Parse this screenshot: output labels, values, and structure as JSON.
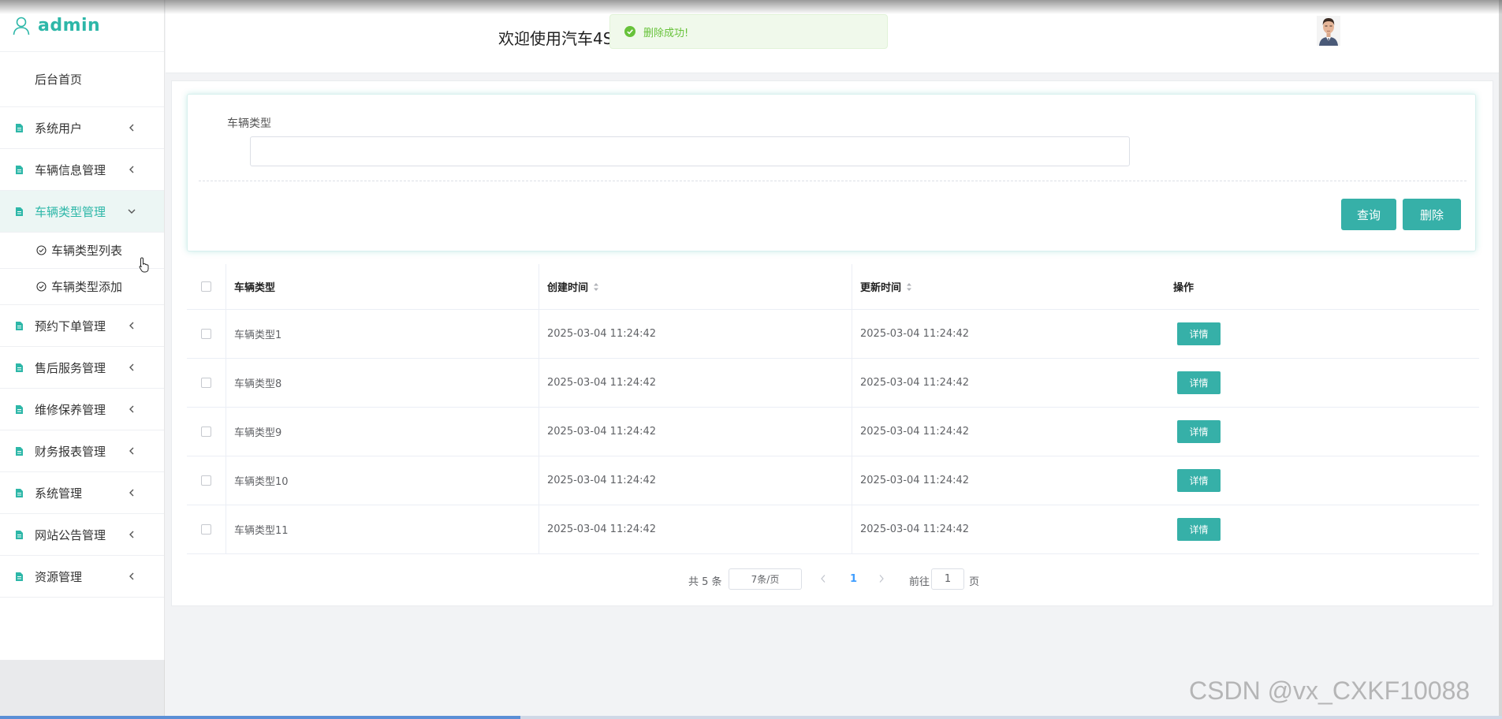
{
  "sidebar": {
    "brand": "admin",
    "home": "后台首页",
    "menu_before": [
      {
        "label": "系统用户"
      },
      {
        "label": "车辆信息管理"
      }
    ],
    "active": {
      "label": "车辆类型管理",
      "children": [
        "车辆类型列表",
        "车辆类型添加"
      ]
    },
    "menu_after": [
      {
        "label": "预约下单管理"
      },
      {
        "label": "售后服务管理"
      },
      {
        "label": "维修保养管理"
      },
      {
        "label": "财务报表管理"
      },
      {
        "label": "系统管理"
      },
      {
        "label": "网站公告管理"
      },
      {
        "label": "资源管理"
      }
    ]
  },
  "header": {
    "welcome": "欢迎使用汽车4S",
    "toast": "删除成功!"
  },
  "search": {
    "label": "车辆类型",
    "value": "",
    "query_button": "查询",
    "delete_button": "删除"
  },
  "table": {
    "columns": [
      "车辆类型",
      "创建时间",
      "更新时间",
      "操作"
    ],
    "rows": [
      {
        "type": "车辆类型1",
        "created": "2025-03-04 11:24:42",
        "updated": "2025-03-04 11:24:42",
        "action": "详情"
      },
      {
        "type": "车辆类型8",
        "created": "2025-03-04 11:24:42",
        "updated": "2025-03-04 11:24:42",
        "action": "详情"
      },
      {
        "type": "车辆类型9",
        "created": "2025-03-04 11:24:42",
        "updated": "2025-03-04 11:24:42",
        "action": "详情"
      },
      {
        "type": "车辆类型10",
        "created": "2025-03-04 11:24:42",
        "updated": "2025-03-04 11:24:42",
        "action": "详情"
      },
      {
        "type": "车辆类型11",
        "created": "2025-03-04 11:24:42",
        "updated": "2025-03-04 11:24:42",
        "action": "详情"
      }
    ]
  },
  "pagination": {
    "total": "共 5 条",
    "page_size": "7条/页",
    "current": "1",
    "goto_label": "前往",
    "goto_value": "1",
    "page_suffix": "页"
  },
  "watermark": "CSDN @vx_CXKF10088",
  "colors": {
    "accent": "#36b0a8",
    "brand": "#2db7a8",
    "toast_text": "#67c23a",
    "page_link": "#409eff"
  },
  "icons": {
    "brand": "user-outline-icon",
    "menu": "document-icon",
    "collapsed": "chevron-left-icon",
    "expanded": "chevron-down-icon",
    "submenu": "check-circle-icon",
    "toast": "success-check-icon",
    "sort": "sort-caret-icon"
  }
}
